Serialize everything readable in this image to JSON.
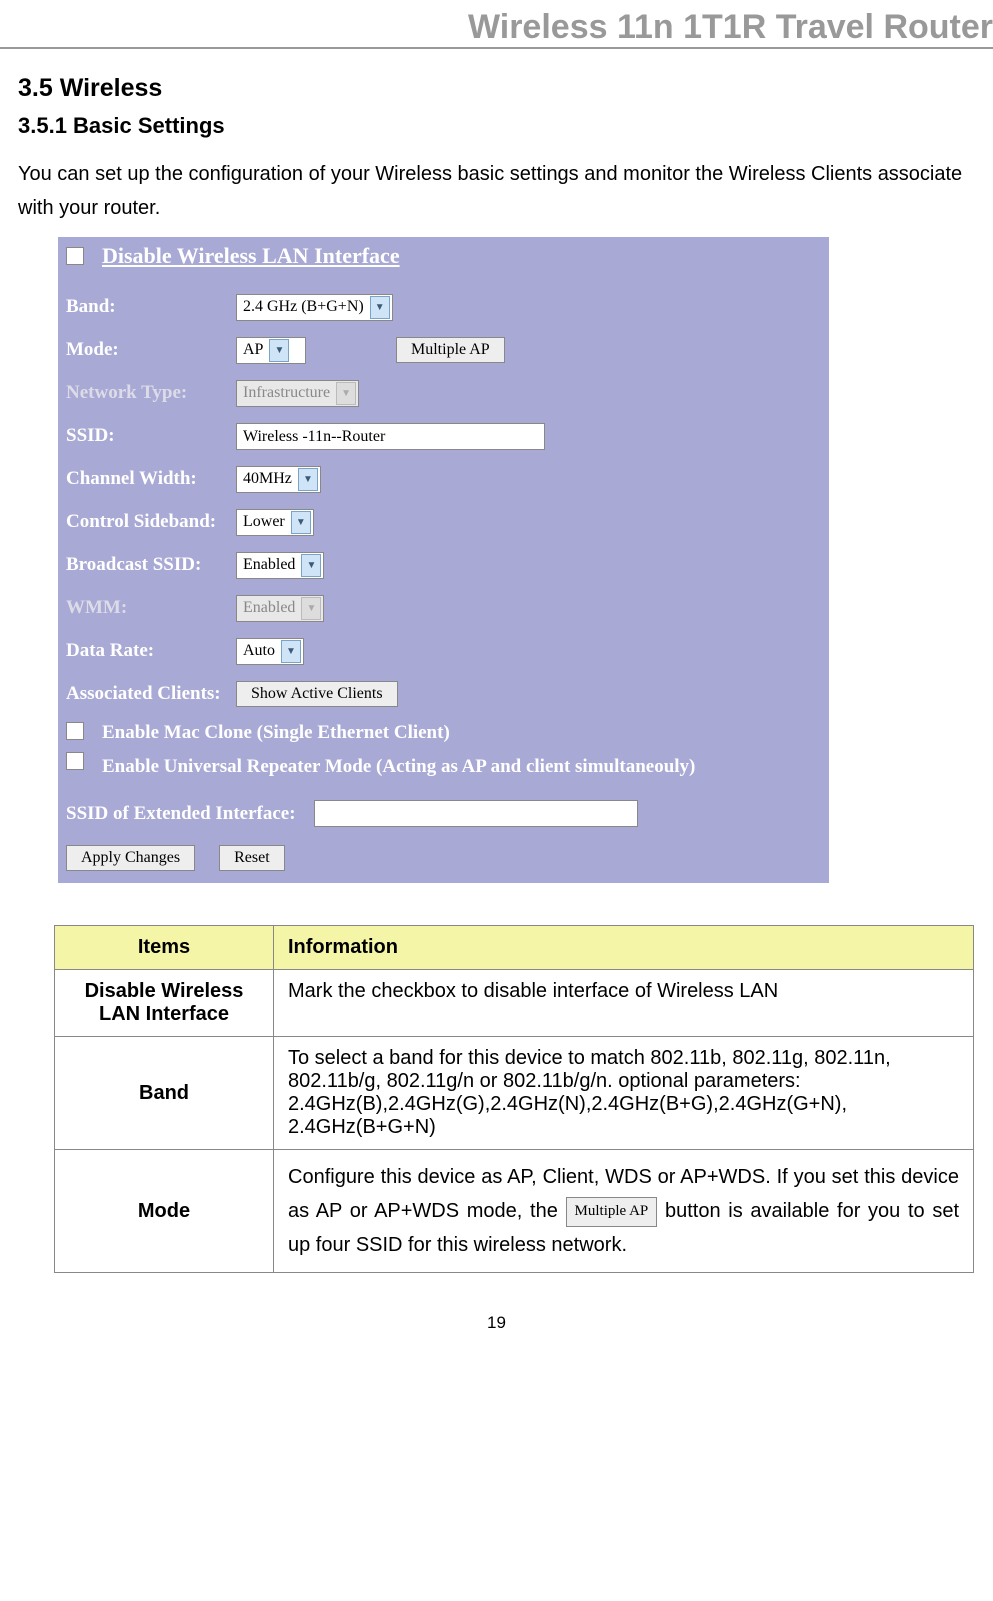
{
  "header": "Wireless 11n 1T1R Travel Router",
  "section_num": "3.5    Wireless",
  "subsection": "3.5.1  Basic Settings",
  "intro": "You can set up the configuration of your Wireless basic settings and monitor the Wireless Clients associate with your router.",
  "panel": {
    "disable_title": "Disable Wireless LAN Interface",
    "band_label": "Band:",
    "band_value": "2.4 GHz (B+G+N)",
    "mode_label": "Mode:",
    "mode_value": "AP",
    "multiple_ap_btn": "Multiple AP",
    "nettype_label": "Network Type:",
    "nettype_value": "Infrastructure",
    "ssid_label": "SSID:",
    "ssid_value": "Wireless -11n--Router",
    "chanwidth_label": "Channel Width:",
    "chanwidth_value": "40MHz",
    "sideband_label": "Control Sideband:",
    "sideband_value": "Lower",
    "bssid_label": "Broadcast SSID:",
    "bssid_value": "Enabled",
    "wmm_label": "WMM:",
    "wmm_value": "Enabled",
    "datarate_label": "Data Rate:",
    "datarate_value": "Auto",
    "assoc_label": "Associated Clients:",
    "show_clients_btn": "Show Active Clients",
    "mac_clone": "Enable Mac Clone (Single Ethernet Client)",
    "repeater": "Enable Universal Repeater Mode (Acting as AP and client simultaneouly)",
    "ssid_ext_label": "SSID of Extended Interface:",
    "apply_btn": "Apply Changes",
    "reset_btn": "Reset"
  },
  "table": {
    "col_items": "Items",
    "col_info": "Information",
    "rows": [
      {
        "item": "Disable Wireless LAN Interface",
        "info": "Mark the checkbox to disable interface of Wireless LAN"
      },
      {
        "item": "Band",
        "info": "To select a band for this device to match 802.11b, 802.11g, 802.11n, 802.11b/g, 802.11g/n or 802.11b/g/n. optional parameters: 2.4GHz(B),2.4GHz(G),2.4GHz(N),2.4GHz(B+G),2.4GHz(G+N), 2.4GHz(B+G+N)"
      },
      {
        "item": "Mode",
        "info_pre": "Configure this device as AP, Client, WDS or AP+WDS. If you set this device as AP or AP+WDS mode, the ",
        "btn": "Multiple AP",
        "info_post": " button is available for you to set up four SSID for this wireless network."
      }
    ]
  },
  "page_number": "19"
}
